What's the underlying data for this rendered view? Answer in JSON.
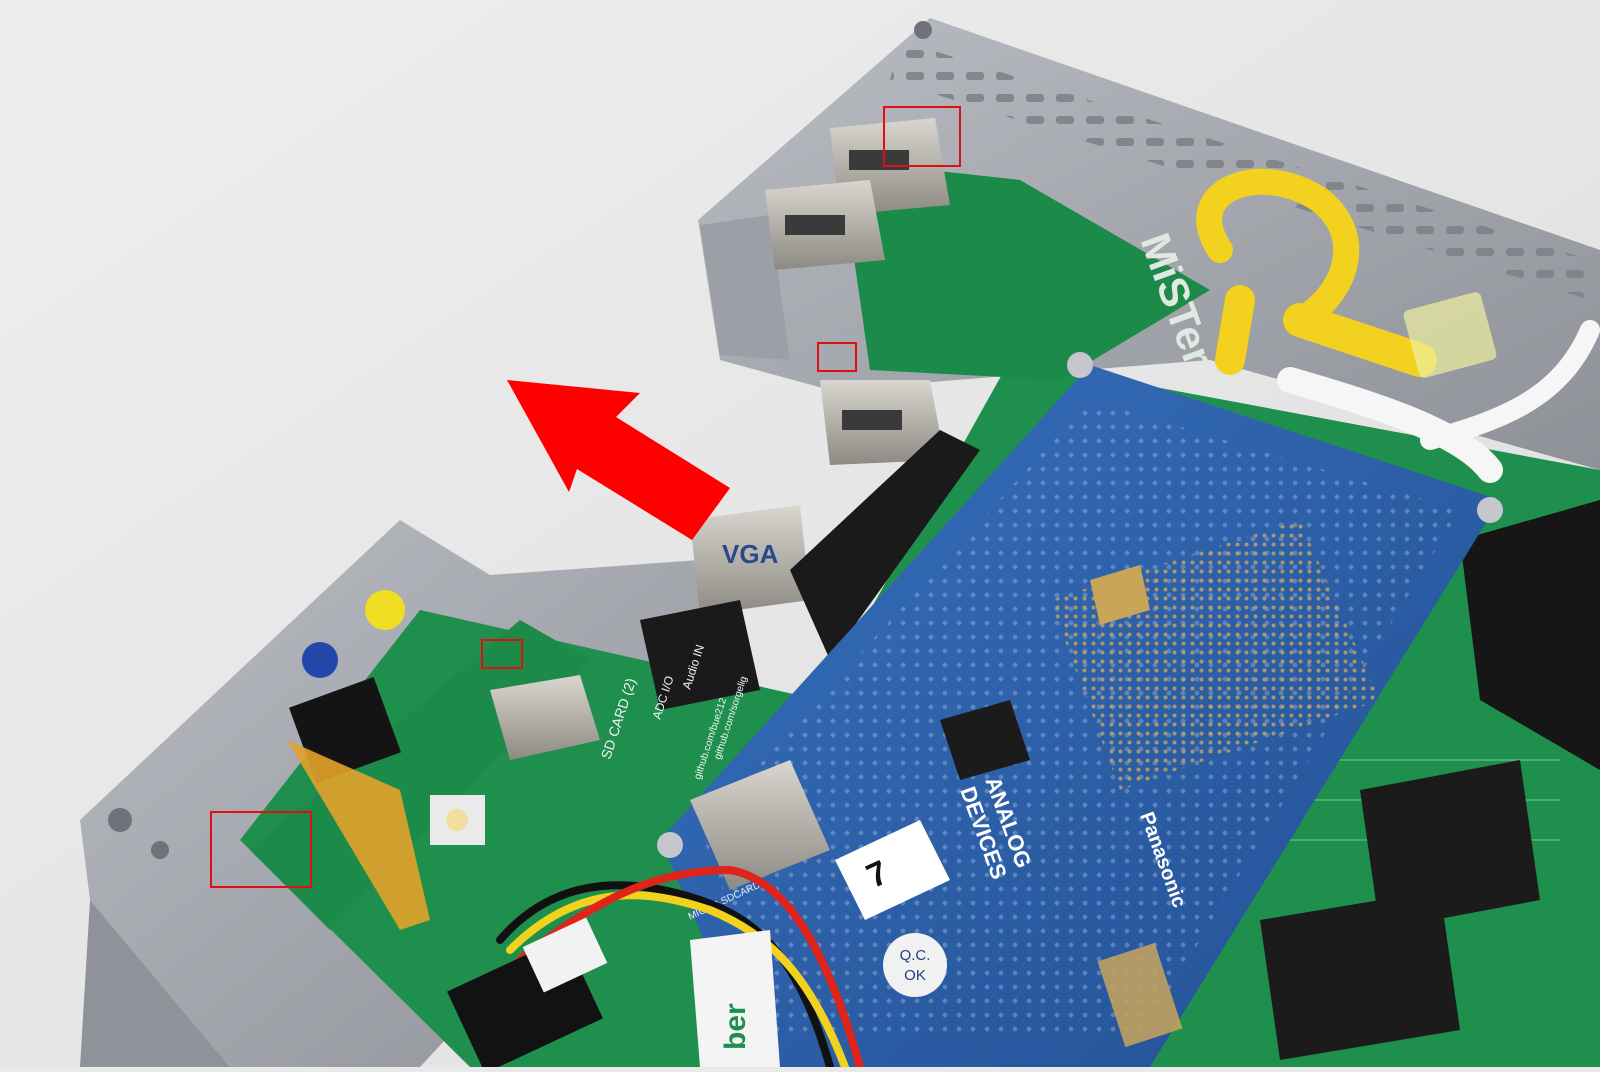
{
  "photo": {
    "background_color": "#e9e9e9",
    "enclosure_color": "#a7aab0",
    "main_board_color": "#1f8f4e",
    "io_board_color": "#1c8a48",
    "adc_board_color": "#2a5ea8",
    "arrow_color": "#ff0000",
    "highlight_box_color": "#e01010",
    "cable_yellow": "#f2d21e"
  },
  "labels": {
    "brand": "MiSTer",
    "vga_label": "VGA",
    "adc_maker_line1": "ANALOG",
    "adc_maker_line2": "DEVICES",
    "module_maker": "Panasonic",
    "qc_line1": "Q.C.",
    "qc_line2": "OK",
    "sticker_mark": "7",
    "micro_sd_label": "MICRO SDCARD",
    "sd_card_label": "SD CARD (2)",
    "audio_label": "Audio IN",
    "adc_io_label": "ADC I/O",
    "repo_line": "github.com/sorgelig",
    "support_line": "github.com/bue212",
    "sticker_text": "ber"
  },
  "annotations": {
    "arrow_direction": "up-left",
    "highlight_count": 4
  }
}
